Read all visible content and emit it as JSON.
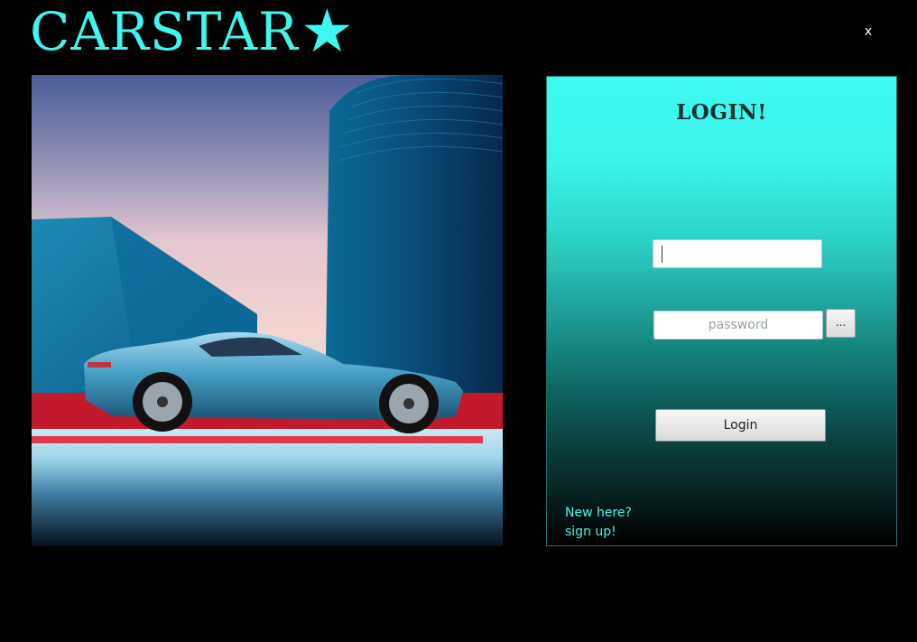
{
  "app": {
    "brand_name": "CARSTAR",
    "brand_star": "★",
    "close_label": "x",
    "accent_color": "#3ef7ee"
  },
  "hero": {
    "icon": "sports-car-image"
  },
  "login": {
    "title": "LOGIN!",
    "username_value": "",
    "password_placeholder": "password",
    "reveal_label": "...",
    "submit_label": "Login",
    "signup_line1": "New here?",
    "signup_line2": "sign up!"
  }
}
